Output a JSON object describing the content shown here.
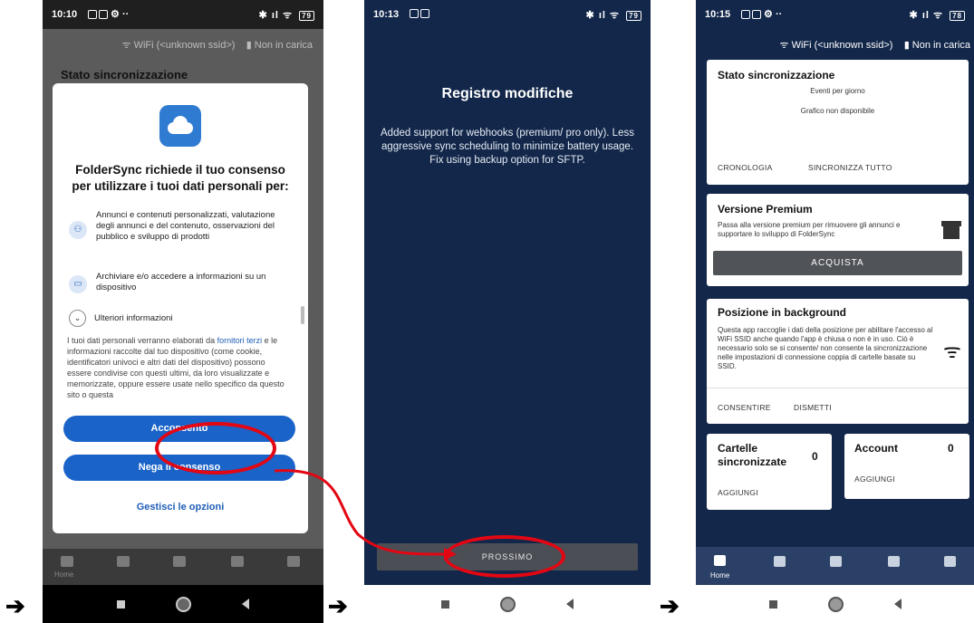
{
  "arrows": [
    "➔",
    "➔",
    "➔"
  ],
  "phone1": {
    "time": "10:10",
    "wifi": "ᯤ WiFi (<unknown ssid>)",
    "charge": "▮ Non in carica",
    "sync_state": "Stato sincronizzazione",
    "dialog": {
      "title": "FolderSync richiede il tuo consenso per utilizzare i tuoi dati personali per:",
      "purpose1": "Annunci e contenuti personalizzati, valutazione degli annunci e del contenuto, osservazioni del pubblico e sviluppo di prodotti",
      "purpose2": "Archiviare e/o accedere a informazioni su un dispositivo",
      "more_info": "Ulteriori informazioni",
      "body_pre": "I tuoi dati personali verranno elaborati da ",
      "body_link": "fornitori terzi",
      "body_post": " e le informazioni raccolte dal tuo dispositivo (come cookie, identificatori univoci e altri dati del dispositivo) possono essere condivise con questi ultimi, da loro visualizzate e memorizzate, oppure essere usate nello specifico da questo sito o questa",
      "consent": "Acconsento",
      "deny": "Nega il consenso",
      "manage": "Gestisci le opzioni"
    },
    "nav_home": "Home"
  },
  "phone2": {
    "time": "10:13",
    "title": "Registro modifiche",
    "notes": "Added support for webhooks (premium/ pro only). Less aggressive sync scheduling to minimize battery usage. Fix using backup option for SFTP.",
    "next": "PROSSIMO"
  },
  "phone3": {
    "time": "10:15",
    "wifi": "ᯤ WiFi (<unknown ssid>)",
    "charge": "▮ Non in carica",
    "sync": {
      "title": "Stato sincronizzazione",
      "subtitle": "Eventi per giorno",
      "empty": "Grafico non disponibile",
      "history": "CRONOLOGIA",
      "sync_all": "SINCRONIZZA TUTTO"
    },
    "premium": {
      "title": "Versione Premium",
      "text": "Passa alla versione premium per rimuovere gli annunci e supportare lo sviluppo di FolderSync",
      "buy": "ACQUISTA"
    },
    "location": {
      "title": "Posizione in background",
      "text": "Questa app raccoglie i dati della posizione per abilitare l'accesso al WiFi SSID anche quando l'app è chiusa o non è in uso. Ciò è necessario solo se si consente/ non consente la sincronizzazione nelle impostazioni di connessione coppia di cartelle basate su SSID.",
      "allow": "CONSENTIRE",
      "dismiss": "DISMETTI"
    },
    "folders": {
      "title": "Cartelle sincronizzate",
      "count": "0",
      "add": "AGGIUNGI"
    },
    "accounts": {
      "title": "Account",
      "count": "0",
      "add": "AGGIUNGI"
    },
    "nav_home": "Home"
  }
}
